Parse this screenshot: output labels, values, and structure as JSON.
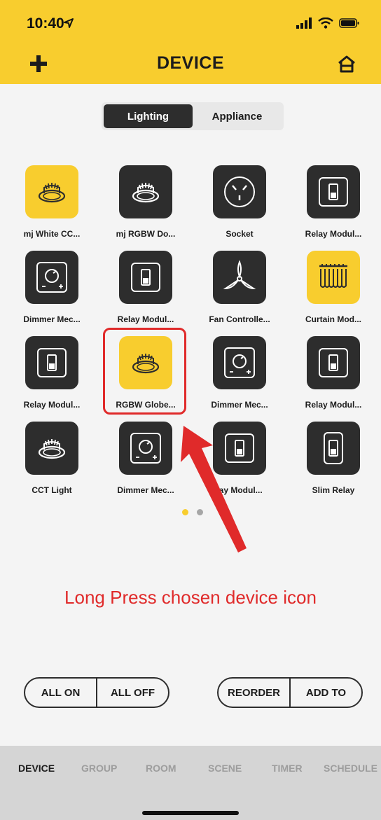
{
  "status": {
    "time": "10:40"
  },
  "header": {
    "title": "DEVICE"
  },
  "segments": {
    "active": "Lighting",
    "inactive": "Appliance"
  },
  "devices": [
    {
      "label": "mj White CC...",
      "icon": "downlight-icon",
      "color": "yellow"
    },
    {
      "label": "mj RGBW Do...",
      "icon": "downlight-icon",
      "color": "dark"
    },
    {
      "label": "Socket",
      "icon": "socket-icon",
      "color": "dark"
    },
    {
      "label": "Relay Modul...",
      "icon": "relay-switch-icon",
      "color": "dark"
    },
    {
      "label": "Dimmer Mec...",
      "icon": "dimmer-icon",
      "color": "dark"
    },
    {
      "label": "Relay Modul...",
      "icon": "relay-switch-icon",
      "color": "dark"
    },
    {
      "label": "Fan Controlle...",
      "icon": "fan-icon",
      "color": "dark"
    },
    {
      "label": "Curtain Mod...",
      "icon": "curtain-icon",
      "color": "yellow"
    },
    {
      "label": "Relay Modul...",
      "icon": "relay-switch-icon",
      "color": "dark"
    },
    {
      "label": "RGBW Globe...",
      "icon": "downlight-icon",
      "color": "yellow"
    },
    {
      "label": "Dimmer Mec...",
      "icon": "dimmer-icon",
      "color": "dark"
    },
    {
      "label": "Relay Modul...",
      "icon": "relay-switch-icon",
      "color": "dark"
    },
    {
      "label": "CCT Light",
      "icon": "downlight-icon",
      "color": "dark"
    },
    {
      "label": "Dimmer Mec...",
      "icon": "dimmer-icon",
      "color": "dark"
    },
    {
      "label": "lay Modul...",
      "icon": "relay-switch-icon",
      "color": "dark"
    },
    {
      "label": "Slim Relay",
      "icon": "slim-relay-icon",
      "color": "dark"
    }
  ],
  "pagination": {
    "pages": 2,
    "current": 1
  },
  "annotation": {
    "text": "Long Press chosen device icon",
    "color": "#e02a2a"
  },
  "controls": {
    "all_on": "ALL ON",
    "all_off": "ALL OFF",
    "reorder": "REORDER",
    "add_to": "ADD TO"
  },
  "tabs": [
    {
      "label": "DEVICE",
      "active": true
    },
    {
      "label": "GROUP",
      "active": false
    },
    {
      "label": "ROOM",
      "active": false
    },
    {
      "label": "SCENE",
      "active": false
    },
    {
      "label": "TIMER",
      "active": false
    },
    {
      "label": "SCHEDULE",
      "active": false
    }
  ],
  "colors": {
    "brand": "#f8cd2e",
    "tile_dark": "#2d2d2d",
    "annotation": "#e02a2a"
  }
}
